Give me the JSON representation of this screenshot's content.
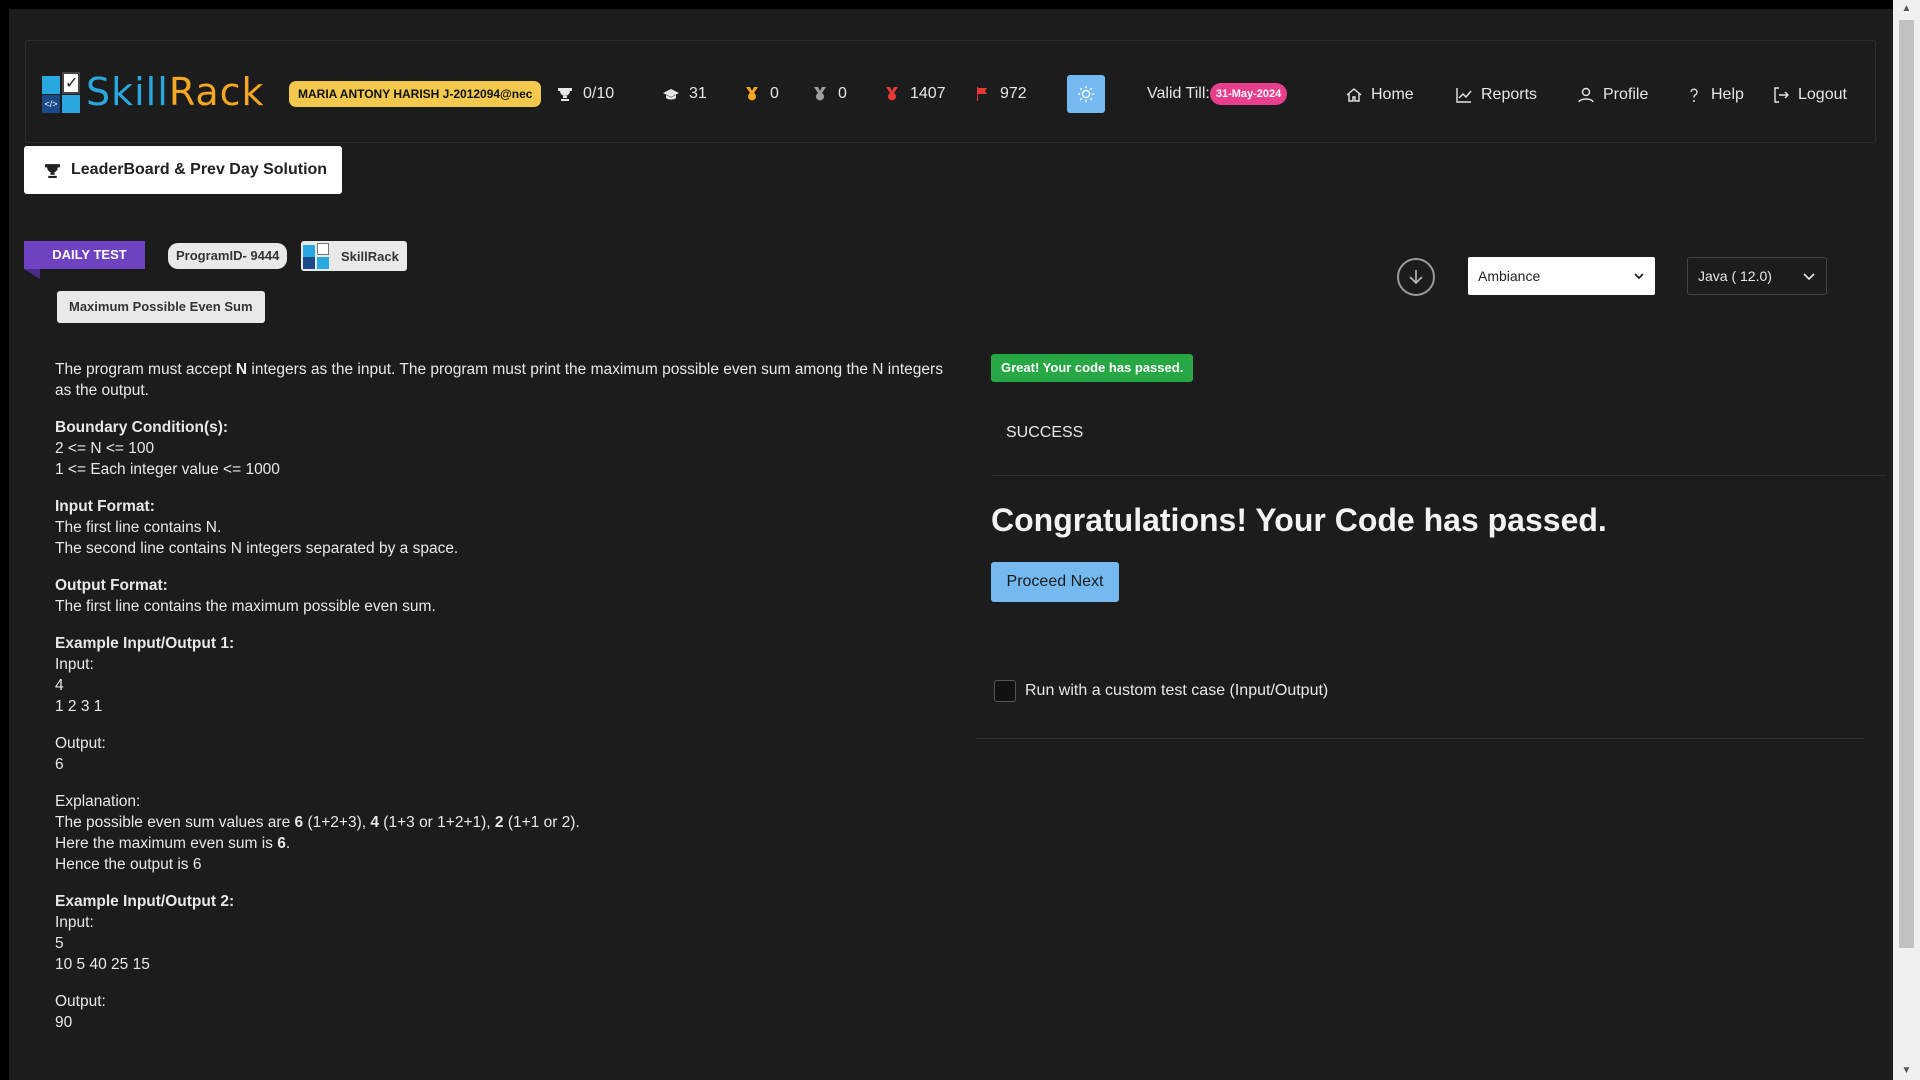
{
  "header": {
    "logo_text_1": "Skill",
    "logo_text_2": "Rack",
    "user": "MARIA ANTONY HARISH J-2012094@nec",
    "stats": [
      {
        "icon": "trophy-icon",
        "value": "0/10",
        "color": "#e6e6e6"
      },
      {
        "icon": "graduation-cap-icon",
        "value": "31",
        "color": "#e6e6e6"
      },
      {
        "icon": "gold-medal-icon",
        "value": "0",
        "color": "#f5a623"
      },
      {
        "icon": "silver-medal-icon",
        "value": "0",
        "color": "#9e9e9e"
      },
      {
        "icon": "red-medal-icon",
        "value": "1407",
        "color": "#e53935"
      },
      {
        "icon": "flag-icon",
        "value": "972",
        "color": "#e53935"
      }
    ],
    "valid_label": "Valid Till:",
    "valid_date": "31-May-2024",
    "nav": [
      {
        "icon": "home-icon",
        "label": "Home"
      },
      {
        "icon": "chart-line-icon",
        "label": "Reports"
      },
      {
        "icon": "user-icon",
        "label": "Profile"
      },
      {
        "icon": "question-icon",
        "label": "Help"
      },
      {
        "icon": "logout-icon",
        "label": "Logout"
      }
    ]
  },
  "leaderboard_label": "LeaderBoard & Prev Day Solution",
  "problem": {
    "tag": "DAILY TEST",
    "program_id": "ProgramID- 9444",
    "source": "SkillRack",
    "title": "Maximum Possible Even Sum",
    "statement_1": "The program must accept ",
    "statement_bold": "N",
    "statement_2": " integers as the input. The program must print the maximum possible even sum among the N integers as the output.",
    "boundary_heading": "Boundary Condition(s):",
    "boundary_1": "2 <= N <= 100",
    "boundary_2": "1 <= Each integer value <= 1000",
    "input_heading": "Input Format:",
    "input_1": "The first line contains N.",
    "input_2": "The second line contains N integers separated by a space.",
    "output_heading": "Output Format:",
    "output_1": "The first line contains the maximum possible even sum.",
    "ex1_heading": "Example Input/Output 1:",
    "ex1_input_label": "Input:",
    "ex1_input_1": "4",
    "ex1_input_2": "1 2 3 1",
    "ex1_output_label": "Output:",
    "ex1_output": "6",
    "explanation_label": "Explanation:",
    "exp_line1_a": "The possible even sum values are ",
    "exp_line1_b": "6",
    "exp_line1_c": " (1+2+3), ",
    "exp_line1_d": "4",
    "exp_line1_e": " (1+3 or 1+2+1), ",
    "exp_line1_f": "2",
    "exp_line1_g": " (1+1 or 2).",
    "exp_line2_a": "Here the maximum even sum is ",
    "exp_line2_b": "6",
    "exp_line2_c": ".",
    "exp_line3": "Hence the output is 6",
    "ex2_heading": "Example Input/Output 2:",
    "ex2_input_label": "Input:",
    "ex2_input_1": "5",
    "ex2_input_2": "10 5 40 25 15",
    "ex2_output_label": "Output:",
    "ex2_output": "90"
  },
  "editor": {
    "theme": "Ambiance",
    "language": "Java ( 12.0)"
  },
  "result": {
    "badge": "Great! Your code has passed.",
    "status": "SUCCESS",
    "message": "Congratulations! Your Code has passed.",
    "proceed_label": "Proceed Next",
    "custom_label": "Run with a custom test case (Input/Output)"
  }
}
